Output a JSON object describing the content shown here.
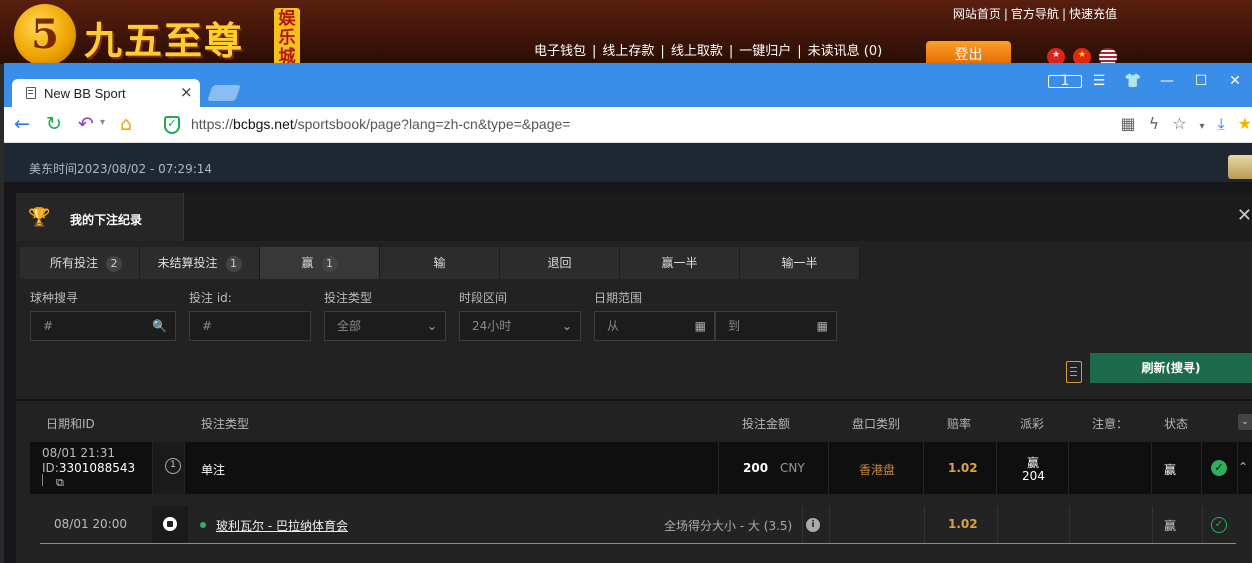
{
  "site": {
    "logo_mark": "5",
    "logo_text": "九五至尊",
    "logo_tag": "娱乐城",
    "top_links": [
      "网站首页",
      "官方导航",
      "快速充值"
    ],
    "nav_links": [
      "电子钱包",
      "线上存款",
      "线上取款",
      "一键归户",
      "未读讯息 (0)"
    ],
    "logout": "登出"
  },
  "browser": {
    "tab_title": "New BB Sport",
    "tab_close": "×",
    "window_badge": "1",
    "url_scheme": "https://",
    "url_host": "bcbgs.net",
    "url_path": "/sportsbook/page?lang=zh-cn&type=&page="
  },
  "page": {
    "time_text": "美东时间2023/08/02 - 07:29:14",
    "panel_title": "我的下注纪录",
    "filter_tabs": [
      {
        "label": "所有投注",
        "count": "2"
      },
      {
        "label": "未结算投注",
        "count": "1"
      },
      {
        "label": "赢",
        "count": "1"
      },
      {
        "label": "输",
        "count": ""
      },
      {
        "label": "退回",
        "count": ""
      },
      {
        "label": "赢一半",
        "count": ""
      },
      {
        "label": "输一半",
        "count": ""
      }
    ],
    "filters": {
      "sport_label": "球种搜寻",
      "sport_placeholder": "#",
      "betid_label": "投注 id:",
      "betid_placeholder": "#",
      "bettype_label": "投注类型",
      "bettype_value": "全部",
      "period_label": "时段区间",
      "period_value": "24小时",
      "date_label": "日期范围",
      "date_from": "从",
      "date_to": "到"
    },
    "refresh_button": "刷新(搜寻)",
    "table_headers": [
      "日期和ID",
      "投注类型",
      "投注金额",
      "盘口类别",
      "赔率",
      "派彩",
      "注意：",
      "状态"
    ],
    "bet": {
      "datetime": "08/01 21:31",
      "id_prefix": "ID:",
      "id": "3301088543",
      "index": "1",
      "type": "单注",
      "amount": "200",
      "currency": "CNY",
      "market": "香港盘",
      "odds": "1.02",
      "payout_label": "赢",
      "payout_value": "204",
      "status": "赢"
    },
    "selection": {
      "datetime": "08/01 20:00",
      "match": "玻利瓦尔 - 巴拉纳体育会",
      "description": "全场得分大小 - 大 (3.5)",
      "odds": "1.02",
      "status": "赢"
    }
  }
}
